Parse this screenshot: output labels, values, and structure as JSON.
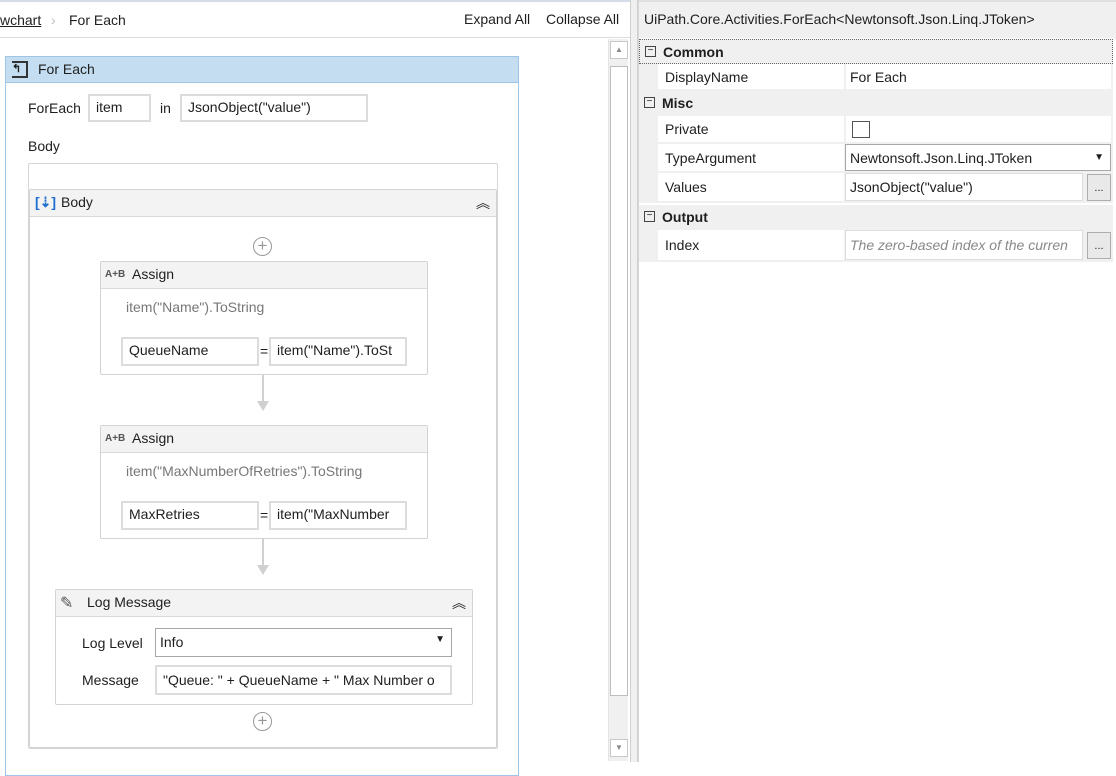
{
  "breadcrumb": {
    "parent": "wchart",
    "current": "For Each"
  },
  "toolbar": {
    "expand_all": "Expand All",
    "collapse_all": "Collapse All"
  },
  "foreach": {
    "title": "For Each",
    "foreach_label": "ForEach",
    "item_value": "item",
    "in_label": "in",
    "values_value": "JsonObject(\"value\")",
    "body_label": "Body"
  },
  "body": {
    "title": "Body"
  },
  "assign1": {
    "title": "Assign",
    "summary": "item(\"Name\").ToString",
    "to": "QueueName",
    "eq": "=",
    "value": "item(\"Name\").ToSt"
  },
  "assign2": {
    "title": "Assign",
    "summary": "item(\"MaxNumberOfRetries\").ToString",
    "to": "MaxRetries",
    "eq": "=",
    "value": "item(\"MaxNumber"
  },
  "log": {
    "title": "Log Message",
    "level_label": "Log Level",
    "level_value": "Info",
    "message_label": "Message",
    "message_value": "\"Queue: \" + QueueName + \" Max Number o"
  },
  "properties": {
    "title": "UiPath.Core.Activities.ForEach<Newtonsoft.Json.Linq.JToken>",
    "categories": {
      "common": "Common",
      "misc": "Misc",
      "output": "Output"
    },
    "display_name_label": "DisplayName",
    "display_name_value": "For Each",
    "private_label": "Private",
    "private_checked": false,
    "type_argument_label": "TypeArgument",
    "type_argument_value": "Newtonsoft.Json.Linq.JToken",
    "values_label": "Values",
    "values_value": "JsonObject(\"value\")",
    "index_label": "Index",
    "index_placeholder": "The zero-based index of the curren",
    "ellipsis": "..."
  },
  "colors": {
    "activity_header": "#c4ddf0",
    "panel_bg": "#f0f0f0"
  }
}
